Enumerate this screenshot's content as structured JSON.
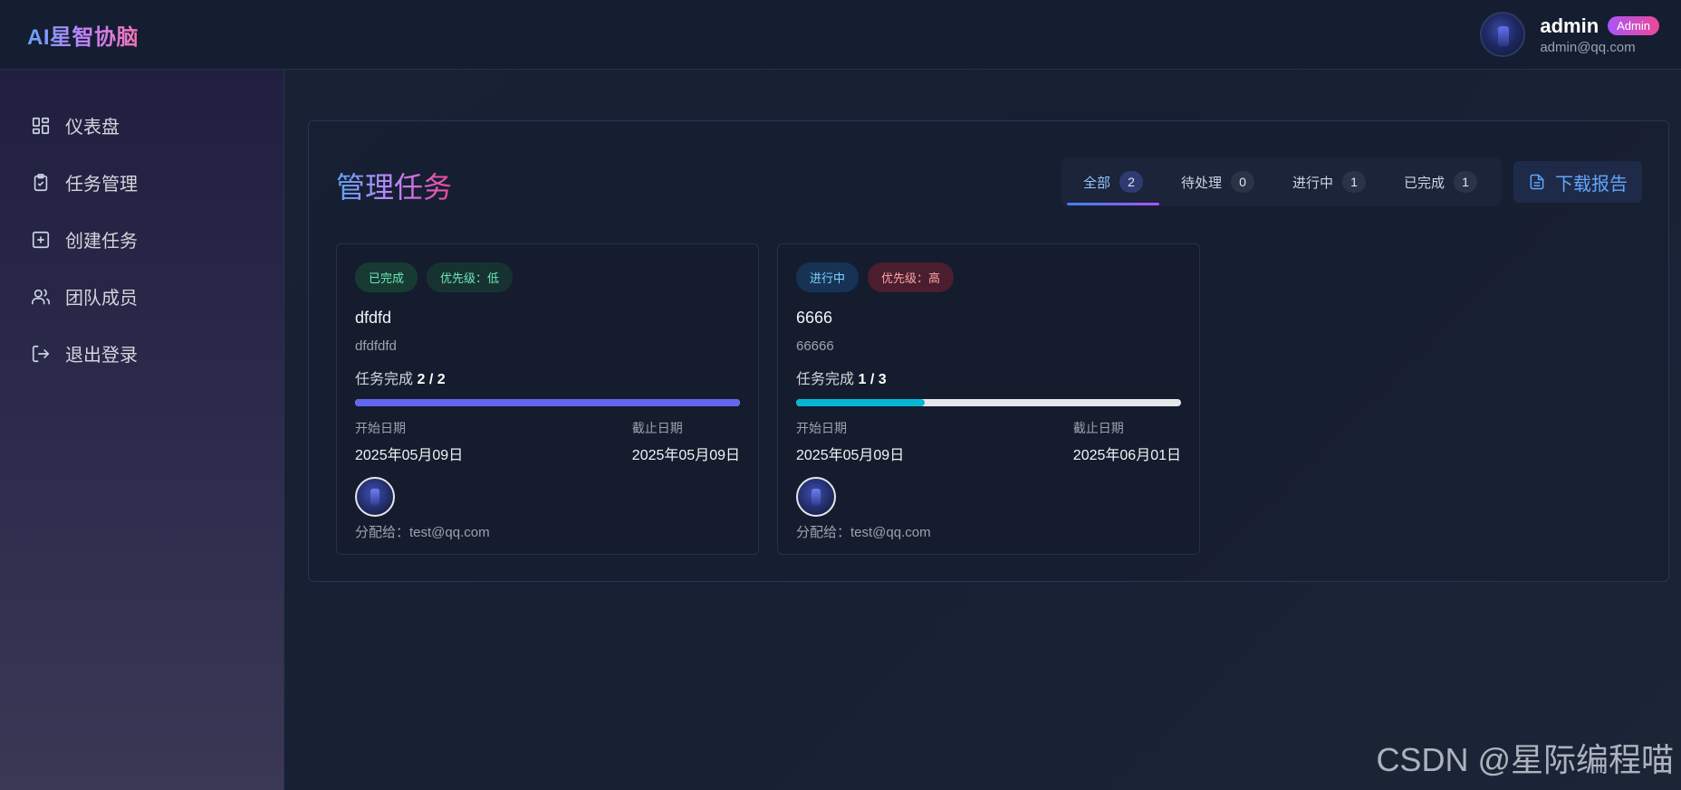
{
  "app": {
    "logo": "AI星智协脑"
  },
  "user": {
    "name": "admin",
    "role": "Admin",
    "email": "admin@qq.com"
  },
  "sidebar": {
    "items": [
      {
        "label": "仪表盘",
        "icon": "dashboard-grid-icon"
      },
      {
        "label": "任务管理",
        "icon": "clipboard-check-icon"
      },
      {
        "label": "创建任务",
        "icon": "plus-square-icon"
      },
      {
        "label": "团队成员",
        "icon": "users-icon"
      },
      {
        "label": "退出登录",
        "icon": "logout-icon"
      }
    ]
  },
  "main": {
    "title": "管理任务",
    "filters": [
      {
        "label": "全部",
        "count": "2",
        "active": true
      },
      {
        "label": "待处理",
        "count": "0",
        "active": false
      },
      {
        "label": "进行中",
        "count": "1",
        "active": false
      },
      {
        "label": "已完成",
        "count": "1",
        "active": false
      }
    ],
    "download_label": "下载报告",
    "cards": [
      {
        "status": "已完成",
        "priority": "优先级：低",
        "title": "dfdfd",
        "description": "dfdfdfd",
        "progress_prefix": "任务完成",
        "progress_value": "2 / 2",
        "progress_fraction": 1.0,
        "progress_color": "#6366f1",
        "start_label": "开始日期",
        "start_date": "2025年05月09日",
        "due_label": "截止日期",
        "due_date": "2025年05月09日",
        "assigned": "分配给：test@qq.com"
      },
      {
        "status": "进行中",
        "priority": "优先级：高",
        "title": "6666",
        "description": "66666",
        "progress_prefix": "任务完成",
        "progress_value": "1 / 3",
        "progress_fraction": 0.333,
        "progress_color": "#06b6d4",
        "start_label": "开始日期",
        "start_date": "2025年05月09日",
        "due_label": "截止日期",
        "due_date": "2025年06月01日",
        "assigned": "分配给：test@qq.com"
      }
    ]
  },
  "watermark": "CSDN @星际编程喵"
}
